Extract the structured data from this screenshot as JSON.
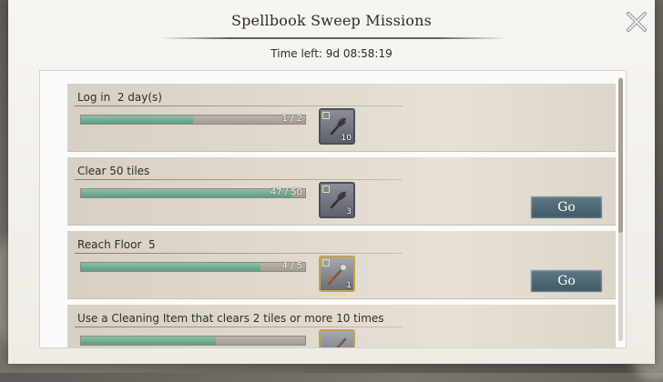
{
  "header": {
    "title": "Spellbook Sweep Missions",
    "time_left": "Time left: 9d 08:58:19"
  },
  "missions": [
    {
      "label": "Log in  2 day(s)",
      "progress_text": "1 / 2",
      "progress": 0.5,
      "reward_icon": "duster-icon",
      "reward_count": "10",
      "go_label": ""
    },
    {
      "label": "Clear 50 tiles",
      "progress_text": "47 / 50",
      "progress": 0.94,
      "reward_icon": "duster-icon",
      "reward_count": "3",
      "go_label": "Go"
    },
    {
      "label": "Reach Floor  5",
      "progress_text": "4 / 5",
      "progress": 0.8,
      "reward_icon": "staff-icon",
      "reward_count": "1",
      "go_label": "Go"
    },
    {
      "label": "Use a Cleaning Item that clears 2 tiles or more 10 times",
      "progress_text": "",
      "progress": 0.6,
      "reward_icon": "staff-icon",
      "reward_count": "",
      "go_label": ""
    }
  ],
  "colors": {
    "progress_fill": "#5a9d86",
    "go_button": "#4f6a75",
    "reward_gold_border": "#c8a24a"
  }
}
